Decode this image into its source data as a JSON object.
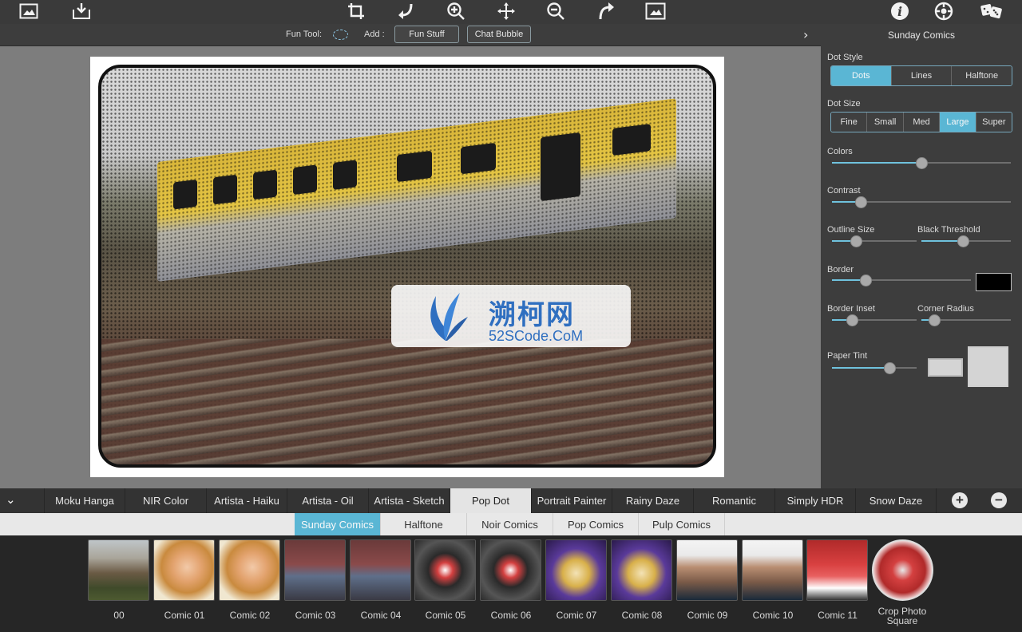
{
  "toolbar": {
    "icons": [
      "open-image-icon",
      "save-image-icon",
      "crop-icon",
      "undo-icon",
      "zoom-in-icon",
      "move-icon",
      "zoom-out-icon",
      "redo-icon",
      "fit-image-icon",
      "info-icon",
      "settings-icon",
      "random-dice-icon"
    ]
  },
  "subbar": {
    "fun_tool_label": "Fun Tool:",
    "add_label": "Add :",
    "fun_stuff_button": "Fun Stuff",
    "chat_bubble_button": "Chat Bubble"
  },
  "watermark": {
    "cn": "溯柯网",
    "en": "52SCode.CoM"
  },
  "panel": {
    "title": "Sunday Comics",
    "dot_style": {
      "label": "Dot Style",
      "options": [
        "Dots",
        "Lines",
        "Halftone"
      ],
      "selected": "Dots"
    },
    "dot_size": {
      "label": "Dot Size",
      "options": [
        "Fine",
        "Small",
        "Med",
        "Large",
        "Super"
      ],
      "selected": "Large"
    },
    "colors": {
      "label": "Colors",
      "value": 0.5
    },
    "contrast": {
      "label": "Contrast",
      "value": 0.16
    },
    "outline_size": {
      "label": "Outline Size",
      "value": 0.28
    },
    "black_threshold": {
      "label": "Black Threshold",
      "value": 0.46
    },
    "border": {
      "label": "Border",
      "value": 0.24,
      "color": "#000000"
    },
    "border_inset": {
      "label": "Border Inset",
      "value": 0.24
    },
    "corner_radius": {
      "label": "Corner Radius",
      "value": 0.14
    },
    "paper_tint": {
      "label": "Paper Tint",
      "value": 0.68,
      "color": "#d4d4d4"
    }
  },
  "filter_tabs": {
    "items": [
      "Moku Hanga",
      "NIR Color",
      "Artista - Haiku",
      "Artista - Oil",
      "Artista - Sketch",
      "Pop Dot",
      "Portrait Painter",
      "Rainy Daze",
      "Romantic",
      "Simply HDR",
      "Snow Daze"
    ],
    "selected": "Pop Dot",
    "add": "+",
    "remove": "−"
  },
  "style_tabs": {
    "items": [
      "Sunday Comics",
      "Halftone",
      "Noir Comics",
      "Pop Comics",
      "Pulp Comics"
    ],
    "selected": "Sunday Comics"
  },
  "presets": {
    "labels": [
      "00",
      "Comic 01",
      "Comic 02",
      "Comic 03",
      "Comic 04",
      "Comic 05",
      "Comic 06",
      "Comic 07",
      "Comic 08",
      "Comic 09",
      "Comic 10",
      "Comic 11",
      "Crop Photo Square"
    ]
  },
  "colors": {
    "accent": "#5ab6d4",
    "panel_bg": "#3d3d3d",
    "canvas_bg": "#7d7d7d"
  }
}
